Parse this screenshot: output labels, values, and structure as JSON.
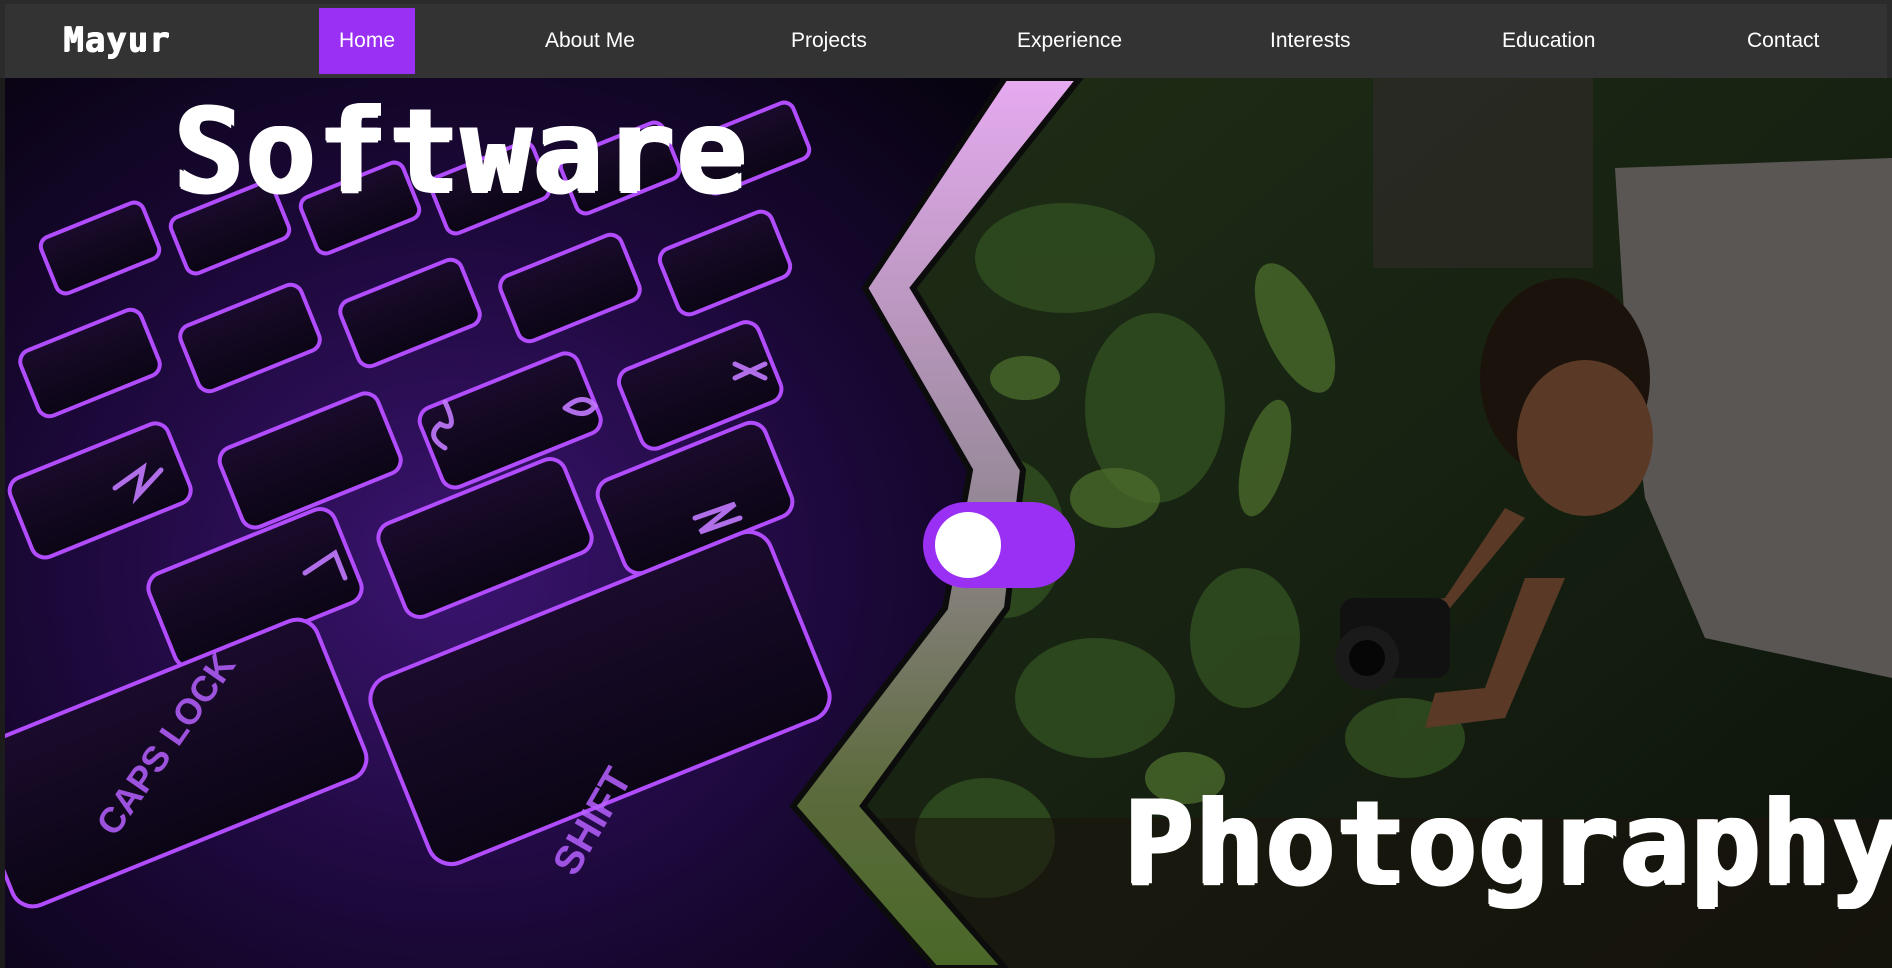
{
  "brand": {
    "name": "Mayur"
  },
  "nav": {
    "items": [
      {
        "label": "Home",
        "active": true
      },
      {
        "label": "About Me",
        "active": false
      },
      {
        "label": "Projects",
        "active": false
      },
      {
        "label": "Experience",
        "active": false
      },
      {
        "label": "Interests",
        "active": false
      },
      {
        "label": "Education",
        "active": false
      },
      {
        "label": "Contact",
        "active": false
      }
    ]
  },
  "hero": {
    "left_title": "Software",
    "right_title": "Photography",
    "left_image": "purple-backlit-keyboard",
    "right_image": "photographer-in-forest",
    "mode_toggle": {
      "state": "left"
    }
  },
  "colors": {
    "accent": "#9b30f5",
    "nav_bg": "#333333",
    "divider_top": "#e3a8ee",
    "divider_bottom": "#4f6b2c",
    "text": "#ffffff"
  }
}
